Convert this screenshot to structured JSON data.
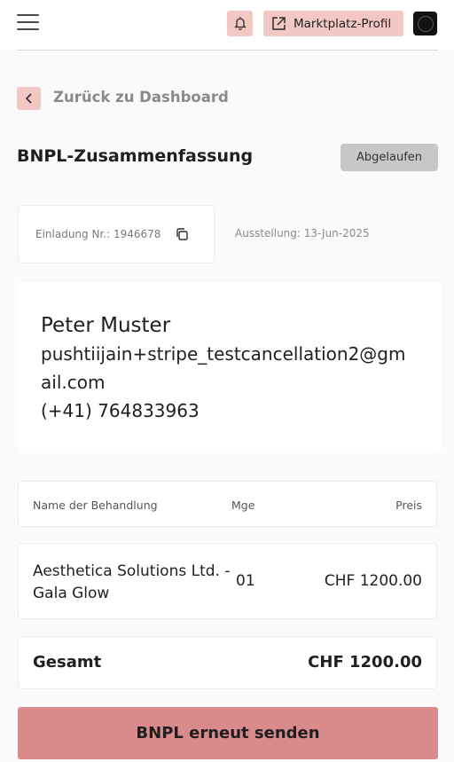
{
  "header": {
    "marketplace_label": "Marktplatz-Profil"
  },
  "nav": {
    "back_label": "Zurück zu Dashboard"
  },
  "summary": {
    "title": "BNPL-Zusammenfassung",
    "status": "Abgelaufen"
  },
  "invoice": {
    "number_label": "Einladung Nr.: 1946678",
    "issue_label": "Ausstellung: 13-Jun-2025"
  },
  "customer": {
    "name": "Peter Muster",
    "email": "pushtiijain+stripe_testcancellation2@gmail.com",
    "phone": "(+41) 764833963"
  },
  "table": {
    "headers": [
      "Name der Behandlung",
      "Mge",
      "Preis"
    ],
    "rows": [
      {
        "name": "Aesthetica Solutions Ltd. - Gala Glow",
        "qty": "01",
        "price": "CHF 1200.00"
      }
    ],
    "total_label": "Gesamt",
    "total_value": "CHF 1200.00"
  },
  "actions": {
    "resend_label": "BNPL erneut senden"
  },
  "colors": {
    "accent_pink": "#f2c7c4",
    "button_rose": "#d98b8b",
    "badge_grey": "#c8c6c6"
  },
  "icons": {
    "menu": "hamburger-icon",
    "bell": "bell-icon",
    "external": "external-link-icon",
    "back": "chevron-left-icon",
    "copy": "copy-icon"
  }
}
